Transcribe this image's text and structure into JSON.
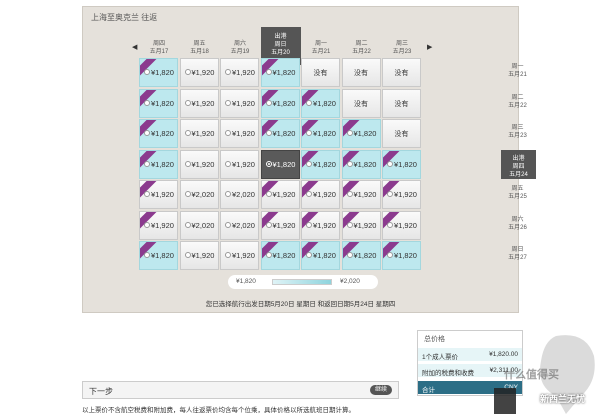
{
  "route_title": "上海至奥克兰 往返",
  "nav": {
    "prev": "◀",
    "next": "▶"
  },
  "columns": [
    {
      "weekday": "周四",
      "date": "五月17",
      "selected": false
    },
    {
      "weekday": "周五",
      "date": "五月18",
      "selected": false
    },
    {
      "weekday": "周六",
      "date": "五月19",
      "selected": false
    },
    {
      "weekday": "周日",
      "date": "五月20",
      "selected": true,
      "tag": "出港"
    },
    {
      "weekday": "周一",
      "date": "五月21",
      "selected": false
    },
    {
      "weekday": "周二",
      "date": "五月22",
      "selected": false
    },
    {
      "weekday": "周三",
      "date": "五月23",
      "selected": false
    }
  ],
  "rows": [
    {
      "weekday": "周一",
      "date": "五月21",
      "selected": false
    },
    {
      "weekday": "周二",
      "date": "五月22",
      "selected": false
    },
    {
      "weekday": "周三",
      "date": "五月23",
      "selected": false
    },
    {
      "weekday": "周四",
      "date": "五月24",
      "selected": true,
      "tag": "出港"
    },
    {
      "weekday": "周五",
      "date": "五月25",
      "selected": false
    },
    {
      "weekday": "周六",
      "date": "五月26",
      "selected": false
    },
    {
      "weekday": "周日",
      "date": "五月27",
      "selected": false
    }
  ],
  "grid": [
    [
      {
        "p": "¥1,820",
        "c": 1,
        "r": 1
      },
      {
        "p": "¥1,920"
      },
      {
        "p": "¥1,920"
      },
      {
        "p": "¥1,820",
        "c": 1,
        "r": 1
      },
      {
        "na": "没有"
      },
      {
        "na": "没有"
      },
      {
        "na": "没有"
      }
    ],
    [
      {
        "p": "¥1,820",
        "c": 1,
        "r": 1
      },
      {
        "p": "¥1,920"
      },
      {
        "p": "¥1,920"
      },
      {
        "p": "¥1,820",
        "c": 1,
        "r": 1
      },
      {
        "p": "¥1,820",
        "c": 1,
        "r": 1
      },
      {
        "na": "没有"
      },
      {
        "na": "没有"
      }
    ],
    [
      {
        "p": "¥1,820",
        "c": 1,
        "r": 1
      },
      {
        "p": "¥1,920"
      },
      {
        "p": "¥1,920"
      },
      {
        "p": "¥1,820",
        "c": 1,
        "r": 1
      },
      {
        "p": "¥1,820",
        "c": 1,
        "r": 1
      },
      {
        "p": "¥1,820",
        "c": 1,
        "r": 1
      },
      {
        "na": "没有"
      }
    ],
    [
      {
        "p": "¥1,820",
        "c": 1,
        "r": 1
      },
      {
        "p": "¥1,920"
      },
      {
        "p": "¥1,920"
      },
      {
        "p": "¥1,820",
        "sel": 1
      },
      {
        "p": "¥1,820",
        "c": 1,
        "r": 1
      },
      {
        "p": "¥1,820",
        "c": 1,
        "r": 1
      },
      {
        "p": "¥1,820",
        "c": 1,
        "r": 1
      }
    ],
    [
      {
        "p": "¥1,920",
        "r": 1
      },
      {
        "p": "¥2,020"
      },
      {
        "p": "¥2,020"
      },
      {
        "p": "¥1,920",
        "r": 1
      },
      {
        "p": "¥1,920",
        "r": 1
      },
      {
        "p": "¥1,920",
        "r": 1
      },
      {
        "p": "¥1,920",
        "r": 1
      }
    ],
    [
      {
        "p": "¥1,920",
        "r": 1
      },
      {
        "p": "¥2,020"
      },
      {
        "p": "¥2,020"
      },
      {
        "p": "¥1,920",
        "r": 1
      },
      {
        "p": "¥1,920",
        "r": 1
      },
      {
        "p": "¥1,920",
        "r": 1
      },
      {
        "p": "¥1,920",
        "r": 1
      }
    ],
    [
      {
        "p": "¥1,820",
        "c": 1,
        "r": 1
      },
      {
        "p": "¥1,920"
      },
      {
        "p": "¥1,920"
      },
      {
        "p": "¥1,820",
        "c": 1,
        "r": 1
      },
      {
        "p": "¥1,820",
        "c": 1,
        "r": 1
      },
      {
        "p": "¥1,820",
        "c": 1,
        "r": 1
      },
      {
        "p": "¥1,820",
        "c": 1,
        "r": 1
      }
    ]
  ],
  "legend": {
    "min": "¥1,820",
    "max": "¥2,020"
  },
  "summary_line": "您已选择航行出发日期5月20日 星期日 和返回日期5月24日 星期四",
  "price_box": {
    "title": "总价格",
    "rows": [
      {
        "label": "1个成人票价",
        "value": "¥1,820.00"
      },
      {
        "label": "附加的税费和收费",
        "value": "¥2,311.00"
      }
    ],
    "total_label": "合计",
    "total_value": "CNY"
  },
  "next_step": {
    "label": "下一步",
    "button": "继续"
  },
  "footnote": "以上票价不含航空税费和附加费，每人往返票价均含每个位乘，具体价格以所选航班日期计算。",
  "watermark": {
    "line1": "什么值得买",
    "line2": "新西兰无忧"
  },
  "colors": {
    "cheap": "#bde8ee",
    "ribbon": "#8b3a8e",
    "selected": "#555555",
    "panel": "#e5e1db"
  }
}
